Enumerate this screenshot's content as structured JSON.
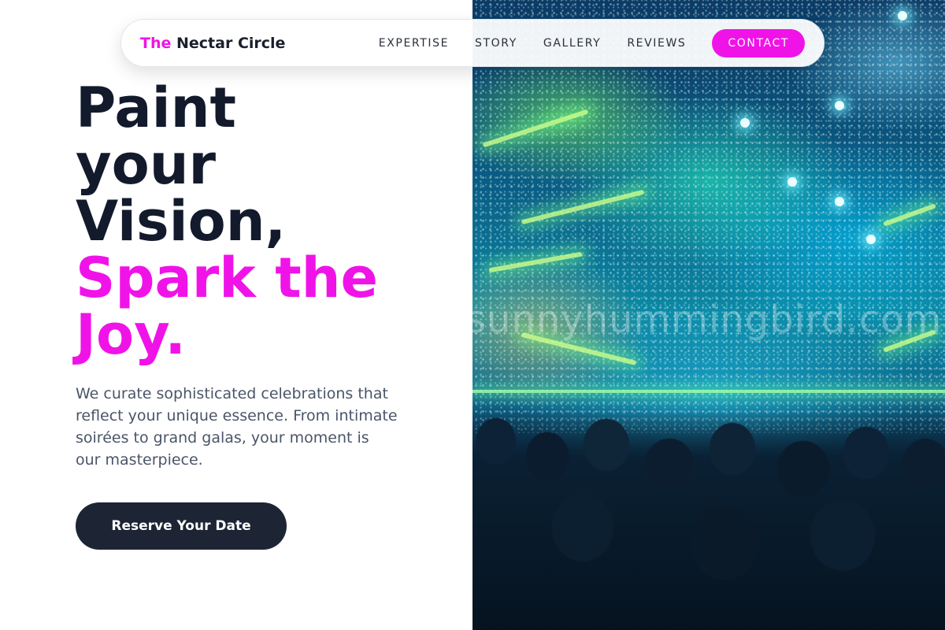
{
  "nav": {
    "brand_accent": "The",
    "brand_rest": "Nectar Circle",
    "links": [
      "EXPERTISE",
      "STORY",
      "GALLERY",
      "REVIEWS"
    ],
    "contact_label": "CONTACT"
  },
  "hero": {
    "headline_lines": [
      "Paint",
      "your",
      "Vision,"
    ],
    "headline_accent_lines": [
      "Spark the",
      "Joy."
    ],
    "description": "We curate sophisticated celebrations that reflect your unique essence. From intimate soirées to grand galas, your moment is our masterpiece.",
    "cta_label": "Reserve Your Date"
  },
  "image": {
    "watermark": "sunnyhummingbird.com"
  },
  "colors": {
    "accent": "#f013e8",
    "dark": "#1d2535",
    "headline": "#121a2c"
  }
}
